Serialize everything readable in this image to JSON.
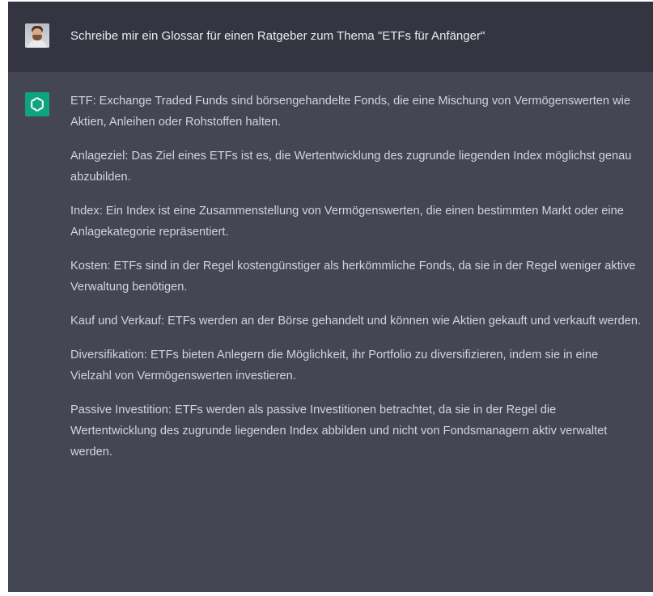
{
  "user_message": {
    "avatar_icon": "user-avatar-photo",
    "text": "Schreibe mir ein Glossar für einen Ratgeber zum Thema \"ETFs für Anfänger\""
  },
  "assistant_message": {
    "avatar_icon": "openai-logo-icon",
    "avatar_color": "#10a37f",
    "paragraphs": [
      "ETF: Exchange Traded Funds sind börsengehandelte Fonds, die eine Mischung von Vermögenswerten wie Aktien, Anleihen oder Rohstoffen halten.",
      "Anlageziel: Das Ziel eines ETFs ist es, die Wertentwicklung des zugrunde liegenden Index möglichst genau abzubilden.",
      "Index: Ein Index ist eine Zusammenstellung von Vermögenswerten, die einen bestimmten Markt oder eine Anlagekategorie repräsentiert.",
      "Kosten: ETFs sind in der Regel kostengünstiger als herkömmliche Fonds, da sie in der Regel weniger aktive Verwaltung benötigen.",
      "Kauf und Verkauf: ETFs werden an der Börse gehandelt und können wie Aktien gekauft und verkauft werden.",
      "Diversifikation: ETFs bieten Anlegern die Möglichkeit, ihr Portfolio zu diversifizieren, indem sie in eine Vielzahl von Vermögenswerten investieren.",
      "Passive Investition: ETFs werden als passive Investitionen betrachtet, da sie in der Regel die Wertentwicklung des zugrunde liegenden Index abbilden und nicht von Fondsmanagern aktiv verwaltet werden."
    ]
  },
  "colors": {
    "user_row_bg": "#343541",
    "assistant_row_bg": "#444654",
    "text": "#d1d5db"
  }
}
